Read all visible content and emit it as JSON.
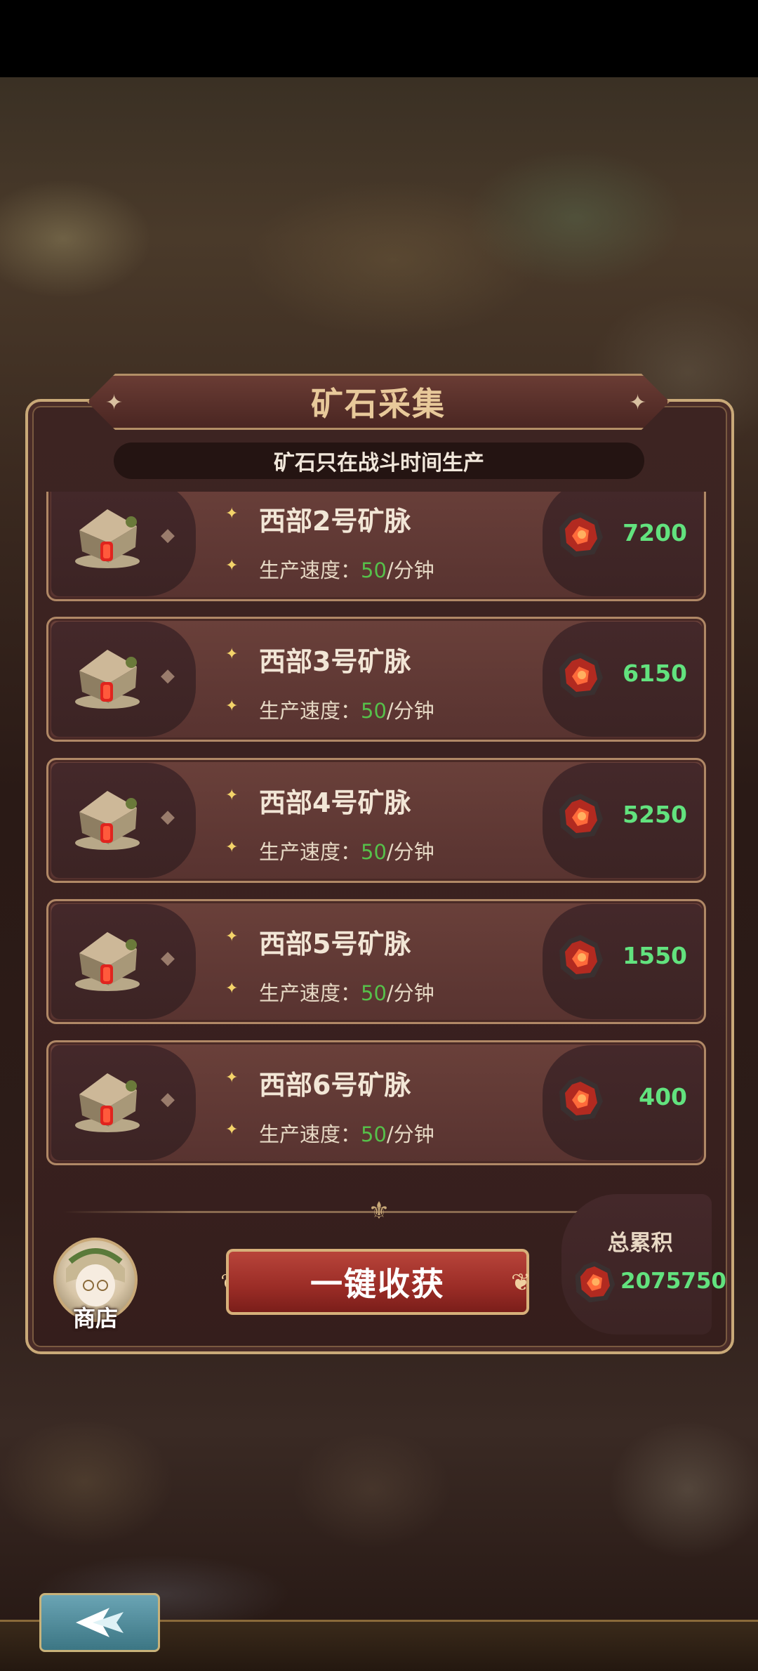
{
  "panel": {
    "title": "矿石采集",
    "subtitle": "矿石只在战斗时间生产"
  },
  "mines": [
    {
      "name": "西部2号矿脉",
      "rate_label": "生产速度：",
      "rate_value": "50",
      "rate_unit": "/分钟",
      "ore": "7200"
    },
    {
      "name": "西部3号矿脉",
      "rate_label": "生产速度：",
      "rate_value": "50",
      "rate_unit": "/分钟",
      "ore": "6150"
    },
    {
      "name": "西部4号矿脉",
      "rate_label": "生产速度：",
      "rate_value": "50",
      "rate_unit": "/分钟",
      "ore": "5250"
    },
    {
      "name": "西部5号矿脉",
      "rate_label": "生产速度：",
      "rate_value": "50",
      "rate_unit": "/分钟",
      "ore": "1550"
    },
    {
      "name": "西部6号矿脉",
      "rate_label": "生产速度：",
      "rate_value": "50",
      "rate_unit": "/分钟",
      "ore": "400"
    }
  ],
  "footer": {
    "shop_label": "商店",
    "harvest_label": "一键收获",
    "total_label": "总累积",
    "total_value": "2075750"
  },
  "icons": {
    "mine": "mine-hut-icon",
    "ore": "red-ore-icon",
    "back": "back-arrow-icon"
  },
  "colors": {
    "ore_amount": "#62e27e",
    "rate_value": "#56c04a",
    "harvest_button": "#9a2c26",
    "panel_border": "#c9a978"
  }
}
